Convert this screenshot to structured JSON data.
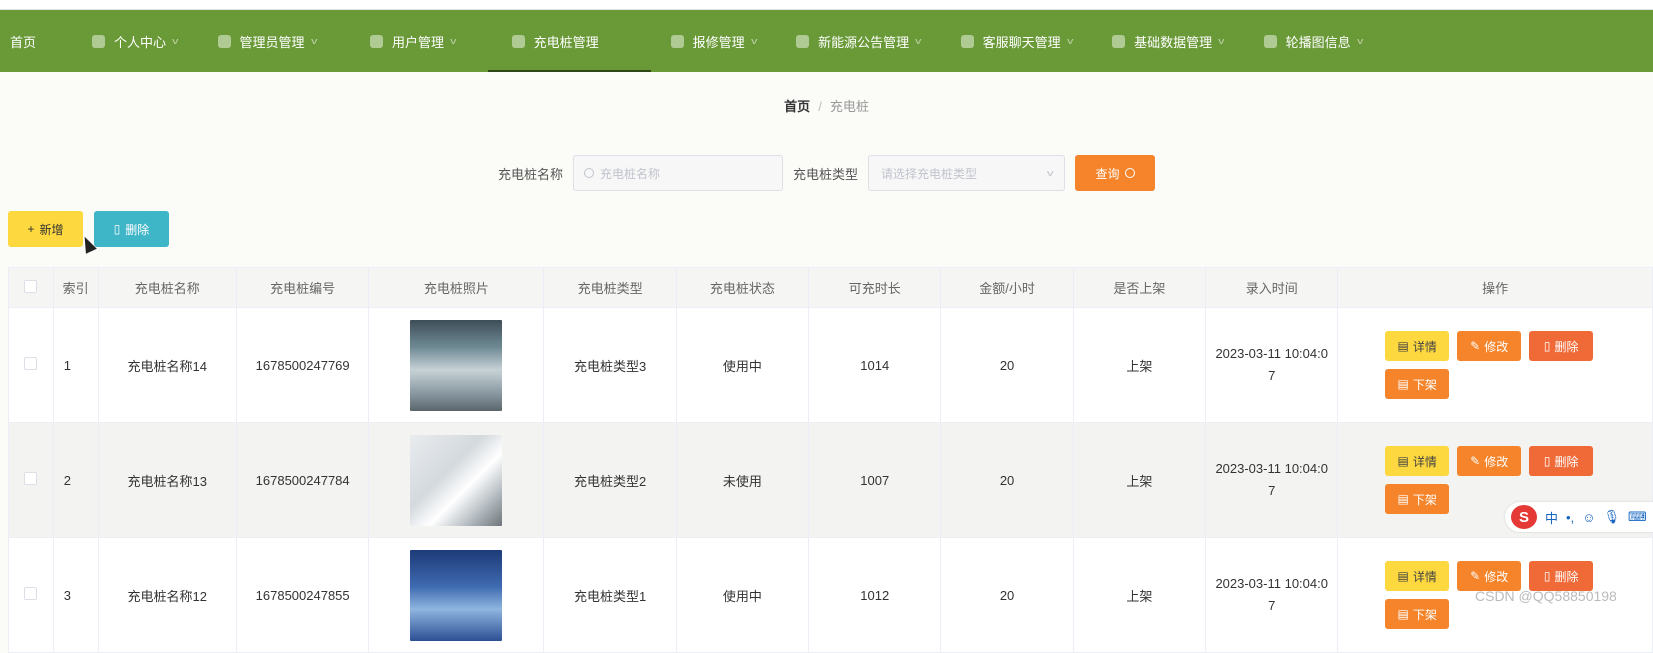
{
  "nav": {
    "items": [
      {
        "label": "首页",
        "icon": "home-icon"
      },
      {
        "label": "个人中心",
        "icon": "user-icon"
      },
      {
        "label": "管理员管理",
        "icon": "chat-icon"
      },
      {
        "label": "用户管理",
        "icon": "calendar-icon"
      },
      {
        "label": "充电桩管理",
        "icon": "flag-icon",
        "active": true
      },
      {
        "label": "报修管理",
        "icon": "clock-icon"
      },
      {
        "label": "新能源公告管理",
        "icon": "clock-icon"
      },
      {
        "label": "客服聊天管理",
        "icon": "shield-icon"
      },
      {
        "label": "基础数据管理",
        "icon": "lock-icon"
      },
      {
        "label": "轮播图信息",
        "icon": "expand-icon"
      }
    ],
    "background": "#6a9a38"
  },
  "breadcrumb": {
    "home": "首页",
    "separator": "/",
    "current": "充电桩"
  },
  "search": {
    "name_label": "充电桩名称",
    "name_placeholder": "充电桩名称",
    "type_label": "充电桩类型",
    "type_placeholder": "请选择充电桩类型",
    "query_label": "查询"
  },
  "actions": {
    "add_label": "新增",
    "delete_label": "删除"
  },
  "table": {
    "headers": [
      "",
      "索引",
      "充电桩名称",
      "充电桩编号",
      "充电桩照片",
      "充电桩类型",
      "充电桩状态",
      "可充时长",
      "金额/小时",
      "是否上架",
      "录入时间",
      "操作"
    ],
    "rows": [
      {
        "index": "1",
        "name": "充电桩名称14",
        "code": "1678500247769",
        "type": "充电桩类型3",
        "status": "使用中",
        "duration": "1014",
        "price": "20",
        "onshelf": "上架",
        "time": "2023-03-11 10:04:07"
      },
      {
        "index": "2",
        "name": "充电桩名称13",
        "code": "1678500247784",
        "type": "充电桩类型2",
        "status": "未使用",
        "duration": "1007",
        "price": "20",
        "onshelf": "上架",
        "time": "2023-03-11 10:04:07"
      },
      {
        "index": "3",
        "name": "充电桩名称12",
        "code": "1678500247855",
        "type": "充电桩类型1",
        "status": "使用中",
        "duration": "1012",
        "price": "20",
        "onshelf": "上架",
        "time": "2023-03-11 10:04:07"
      }
    ],
    "op_labels": {
      "detail": "详情",
      "edit": "修改",
      "remove": "删除",
      "shelf": "下架"
    }
  },
  "ime": {
    "logo": "S",
    "mode": "中",
    "punct": "•,"
  },
  "watermark": "CSDN @QQ58850198",
  "colors": {
    "accent_orange": "#f5842a",
    "yellow": "#fdd83f",
    "teal": "#3fb5c8",
    "red_orange": "#f06a38"
  }
}
